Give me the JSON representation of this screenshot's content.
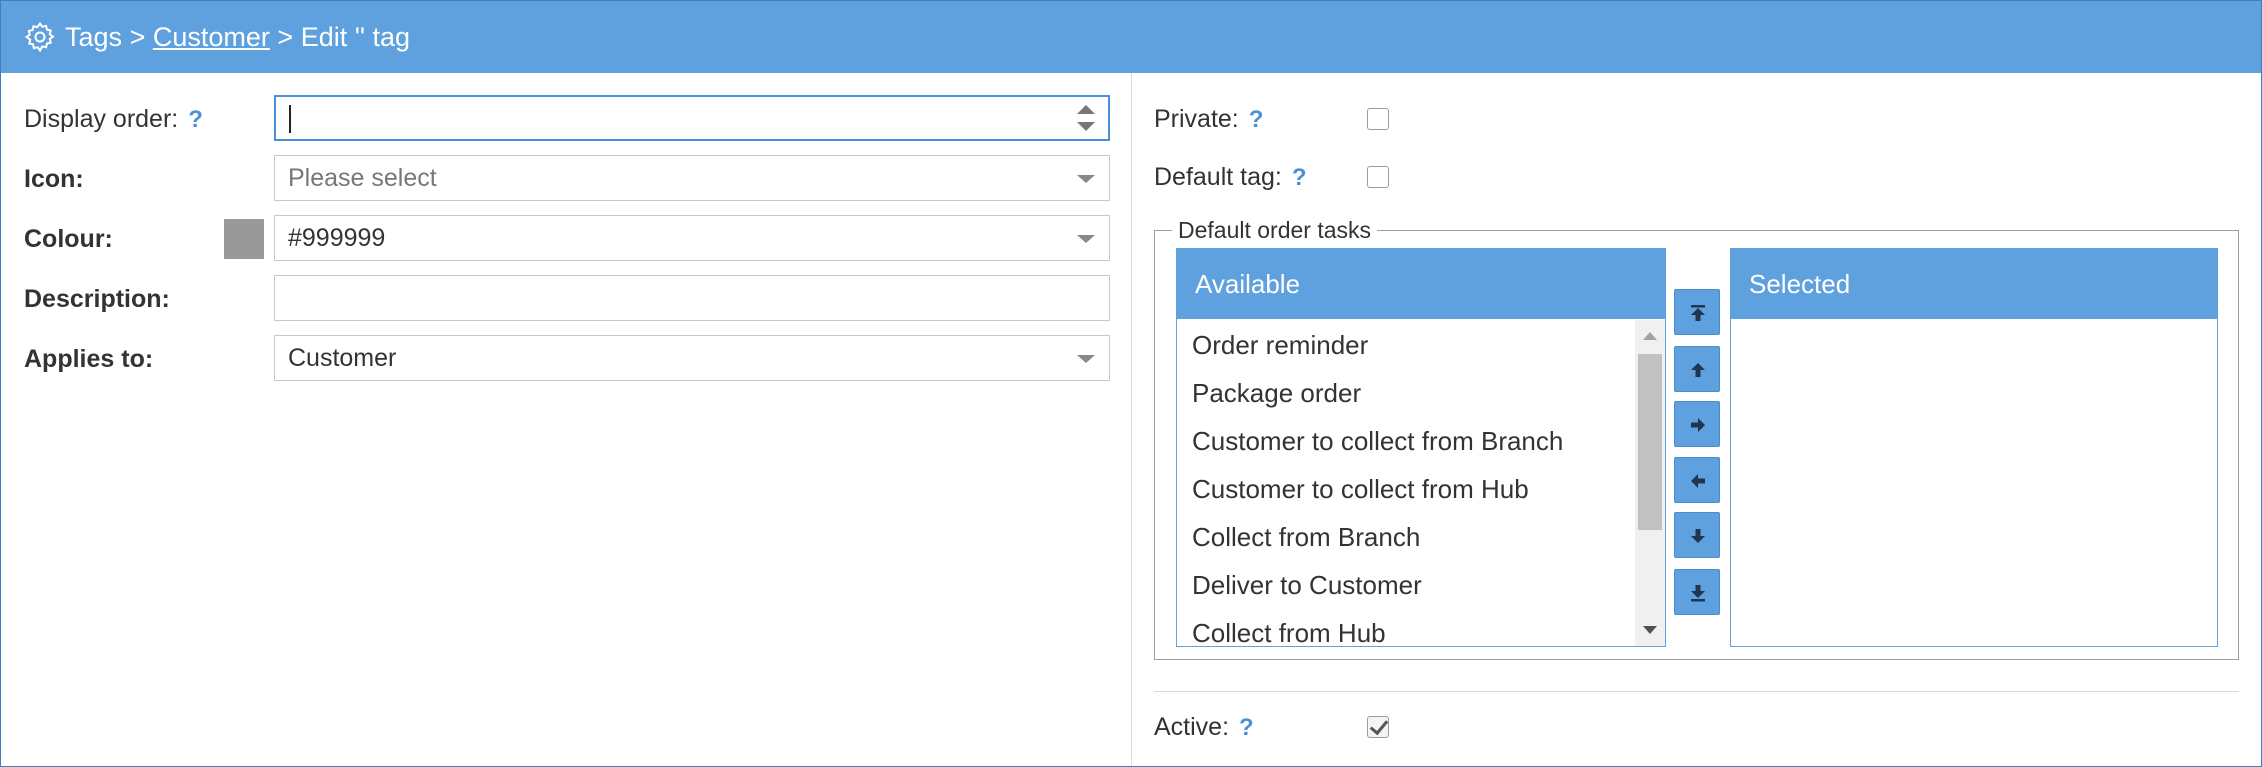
{
  "breadcrumb": {
    "root": "Tags",
    "sep1": ">",
    "link": "Customer",
    "sep2": ">",
    "current": "Edit '' tag"
  },
  "left_form": {
    "display_order_label": "Display order:",
    "display_order_value": "",
    "icon_label": "Icon:",
    "icon_placeholder": "Please select",
    "colour_label": "Colour:",
    "colour_value": "#999999",
    "description_label": "Description:",
    "description_value": "",
    "applies_to_label": "Applies to:",
    "applies_to_value": "Customer",
    "help_glyph": "?"
  },
  "right_form": {
    "private_label": "Private:",
    "private_checked": false,
    "default_tag_label": "Default tag:",
    "default_tag_checked": false,
    "tasks_legend": "Default order tasks",
    "available_header": "Available",
    "selected_header": "Selected",
    "available_items": [
      "Order reminder",
      "Package order",
      "Customer to collect from Branch",
      "Customer to collect from Hub",
      "Collect from Branch",
      "Deliver to Customer",
      "Collect from Hub"
    ],
    "selected_items": [],
    "move_buttons": [
      "move-to-top",
      "move-up",
      "move-right",
      "move-left",
      "move-down",
      "move-to-bottom"
    ],
    "active_label": "Active:",
    "active_checked": true
  },
  "colors": {
    "header_blue": "#5fa1de",
    "swatch": "#999999",
    "help_blue": "#4a90d9"
  }
}
